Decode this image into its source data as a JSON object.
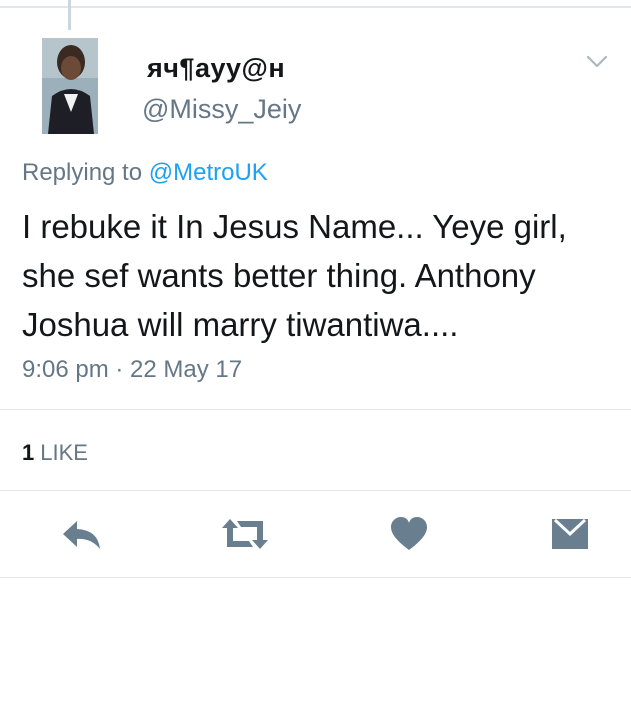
{
  "user": {
    "display_name": "яч¶ауу@н",
    "handle": "@Missy_Jeiy",
    "avatar": "profile-photo"
  },
  "reply": {
    "prefix": "Replying to",
    "mention": "@MetroUK"
  },
  "tweet": {
    "text": "I rebuke it In Jesus Name... Yeye girl, she sef wants better thing. Anthony Joshua will marry tiwantiwa....",
    "timestamp": "9:06 pm · 22 May 17"
  },
  "stats": {
    "like_count": "1",
    "like_label": "LIKE"
  },
  "actions": {
    "icons": [
      "reply-icon",
      "retweet-icon",
      "like-icon",
      "message-icon"
    ]
  },
  "colors": {
    "text": "#14171a",
    "muted": "#657786",
    "link": "#1da1f2",
    "icon": "#697f8f",
    "divider": "#e1e8ed"
  }
}
